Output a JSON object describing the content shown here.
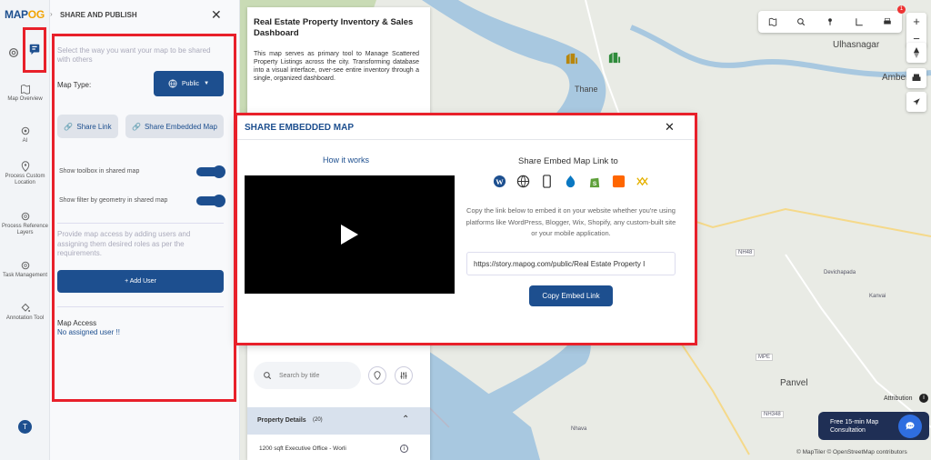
{
  "logo": {
    "text_a": "MAP",
    "text_b": "OG"
  },
  "rail": {
    "items": [
      {
        "label": "Map Overview"
      },
      {
        "label": "AI"
      },
      {
        "label": "Process Custom Location"
      },
      {
        "label": "Process Reference Layers"
      },
      {
        "label": "Task Management"
      },
      {
        "label": "Annotation Tool"
      }
    ],
    "avatar": "T"
  },
  "panel": {
    "title": "SHARE AND PUBLISH",
    "intro": "Select the way you want your map to be shared with others",
    "map_type_label": "Map Type:",
    "map_type_value": "Public",
    "share_link": "Share Link",
    "share_embedded": "Share Embedded Map",
    "toggle_toolbox": "Show toolbox in shared map",
    "toggle_filter": "Show filter by geometry in shared map",
    "access_text": "Provide map access by adding users and assigning them desired roles as per the requirements.",
    "add_user": "+ Add User",
    "map_access_title": "Map Access",
    "map_access_value": "No assigned user !!"
  },
  "story": {
    "title": "Real Estate Property Inventory & Sales Dashboard",
    "description": "This map serves as primary tool to Manage Scattered Property Listings across the city. Transforming database into a visual interface, over-see entire inventory through a single, organized dashboard.",
    "search_placeholder": "Search by title",
    "details_label": "Property Details",
    "details_count": "(20)",
    "first_item": "1200 sqft Executive Office - Worli"
  },
  "modal": {
    "title": "SHARE EMBEDDED MAP",
    "how_it_works": "How it works",
    "share_to": "Share Embed Map Link to",
    "platform_icons": [
      "wordpress-icon",
      "globe-icon",
      "mobile-icon",
      "drupal-icon",
      "shopify-icon",
      "blogger-icon",
      "wix-icon"
    ],
    "description": "Copy the link below to embed it on your website whether you're using platforms like WordPress, Blogger, Wix, Shopify, any custom-built site or your mobile application.",
    "link": "https://story.mapog.com/public/Real Estate Property I",
    "copy_button": "Copy Embed Link"
  },
  "map": {
    "labels": {
      "ulhasnagar": "Ulhasnagar",
      "thane": "Thane",
      "amber": "Amber",
      "panvel": "Panvel",
      "devichapada": "Devichapada",
      "nhava": "Nhava",
      "kanvai": "Kanvai",
      "nh48": "NH48",
      "nh348": "NH348",
      "mpe": "MPE"
    },
    "attribution": "Attribution",
    "footer": "© MapTiler © OpenStreetMap contributors",
    "consultation": "Free 15-min Map Consultation",
    "notification_count": "1"
  },
  "colors": {
    "accent": "#1d4f8f",
    "highlight": "#e8202a"
  }
}
